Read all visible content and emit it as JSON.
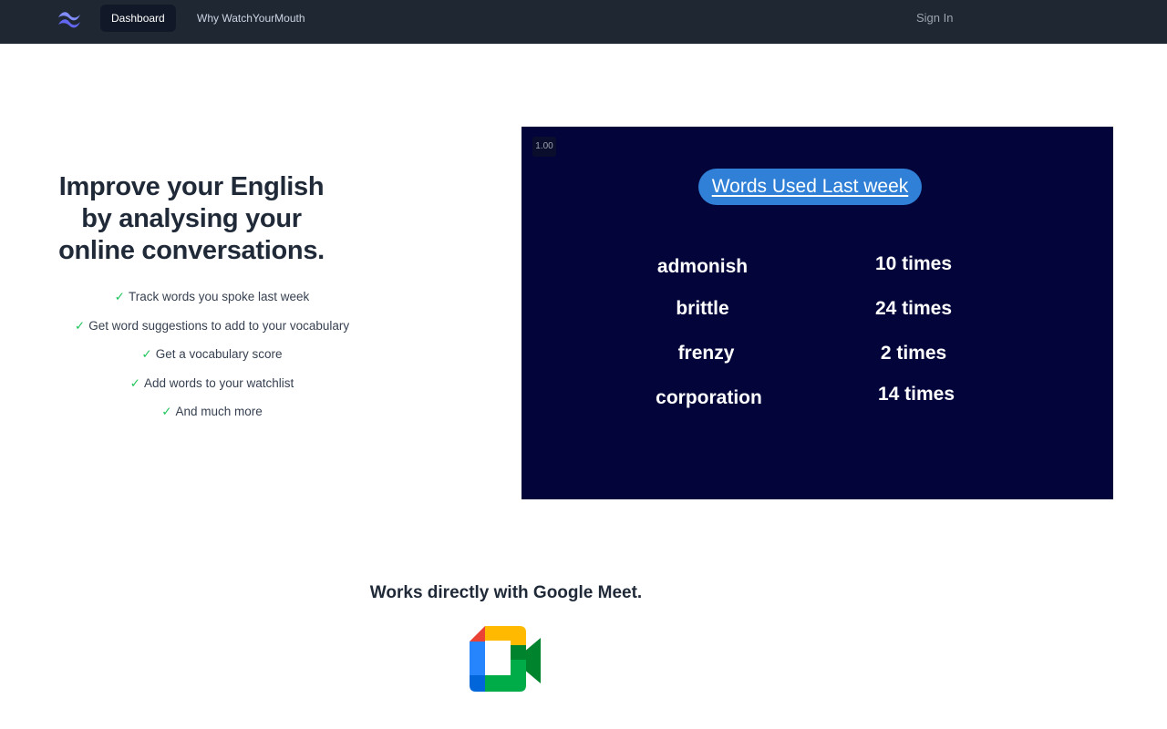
{
  "nav": {
    "logo_icon": "tailwind-wave-icon",
    "items": [
      {
        "label": "Dashboard",
        "active": true
      },
      {
        "label": "Why WatchYourMouth",
        "active": false
      }
    ],
    "sign_in": "Sign In"
  },
  "hero": {
    "title_lines": [
      "Improve your English",
      "by analysing your",
      "online conversations."
    ],
    "check_glyph": "✓",
    "features": [
      "Track words you spoke last week",
      "Get word suggestions to add to your vocabulary",
      "Get a vocabulary score",
      "Add words to your watchlist",
      "And much more"
    ]
  },
  "video": {
    "speed": "1.00",
    "title": "Words Used Last week",
    "rows": [
      {
        "word": "admonish",
        "count": "10 times"
      },
      {
        "word": "brittle",
        "count": "24 times"
      },
      {
        "word": "frenzy",
        "count": "2 times"
      },
      {
        "word": "corporation",
        "count": "14 times"
      }
    ]
  },
  "integration": {
    "title": "Works directly with Google Meet.",
    "logo_icon": "google-meet-icon"
  },
  "colors": {
    "nav_bg": "#1f2733",
    "slide_bg": "#03053a",
    "slide_title_bg": "#2f80d6",
    "check_green": "#22c55e"
  }
}
